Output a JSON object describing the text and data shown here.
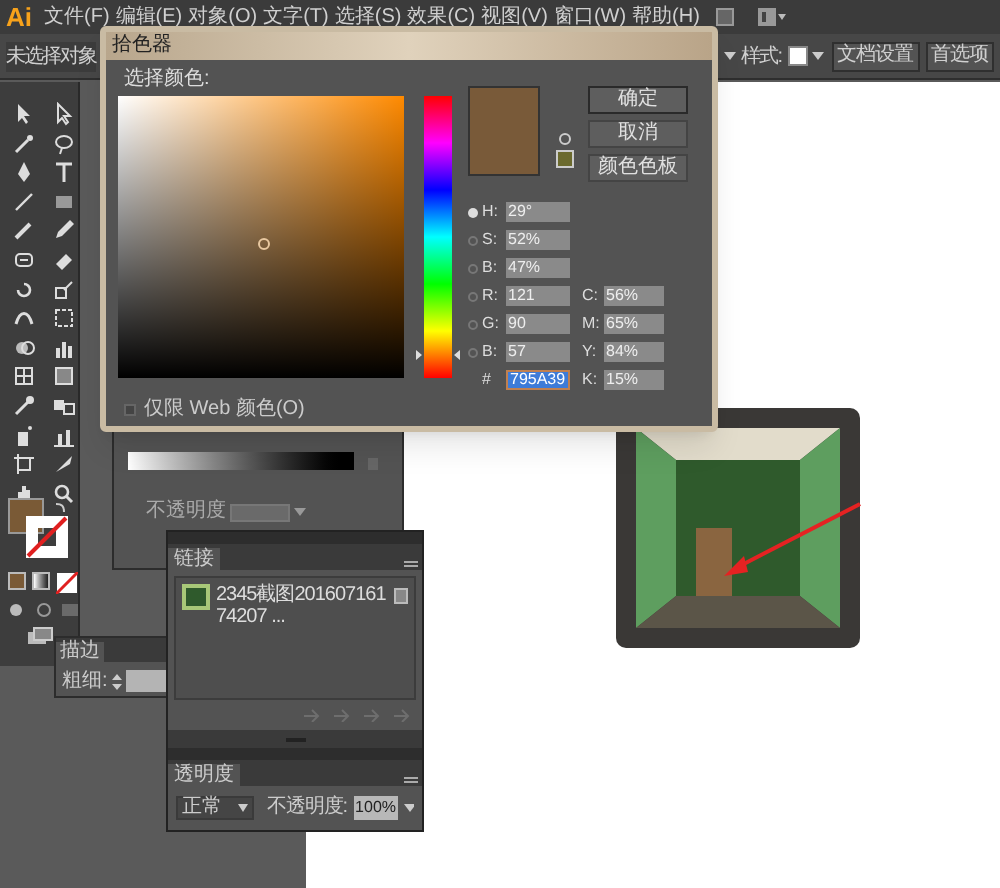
{
  "app_logo": "Ai",
  "menu_bar": {
    "items": [
      "文件(F)",
      "编辑(E)",
      "对象(O)",
      "文字(T)",
      "选择(S)",
      "效果(C)",
      "视图(V)",
      "窗口(W)",
      "帮助(H)"
    ]
  },
  "control_bar": {
    "selection_status": "未选择对象",
    "style_label": "样式:",
    "buttons": [
      "文档设置",
      "首选项"
    ]
  },
  "color_picker": {
    "title": "拾色器",
    "prompt": "选择颜色:",
    "hue_slider": {
      "level": 0.08
    },
    "buttons": [
      "确定",
      "取消",
      "颜色色板"
    ],
    "fields": [
      {
        "kind": "radio",
        "label": "H:",
        "value": "29°",
        "selected": true
      },
      {
        "kind": "radio",
        "label": "S:",
        "value": "52%",
        "selected": false
      },
      {
        "kind": "radio",
        "label": "B:",
        "value": "47%",
        "selected": false
      },
      {
        "kind": "radio",
        "label": "R:",
        "value": "121",
        "selected": false
      },
      {
        "kind": "radio",
        "label": "G:",
        "value": "90",
        "selected": false
      },
      {
        "kind": "radio",
        "label": "B:",
        "value": "57",
        "selected": false
      },
      {
        "kind": "hex",
        "label": "#",
        "value": "795A39"
      }
    ],
    "cmyk_fields": [
      {
        "label": "C:",
        "value": "56%"
      },
      {
        "label": "M:",
        "value": "65%"
      },
      {
        "label": "Y:",
        "value": "84%"
      },
      {
        "label": "K:",
        "value": "15%"
      }
    ],
    "web_colors_only": {
      "label": "仅限 Web 颜色(O)",
      "checked": false
    }
  },
  "gradient_panel": {
    "opacity_label": "不透明度"
  },
  "stroke_panel": {
    "tab": "描边",
    "weight_label": "粗细:"
  },
  "links_panel": {
    "tab": "链接",
    "items": [
      {
        "name": "2345截图20160716174207 ..."
      }
    ]
  },
  "transparency_panel": {
    "tab": "透明度",
    "blend_mode": "正常",
    "opacity_label": "不透明度:",
    "opacity": "100%"
  }
}
